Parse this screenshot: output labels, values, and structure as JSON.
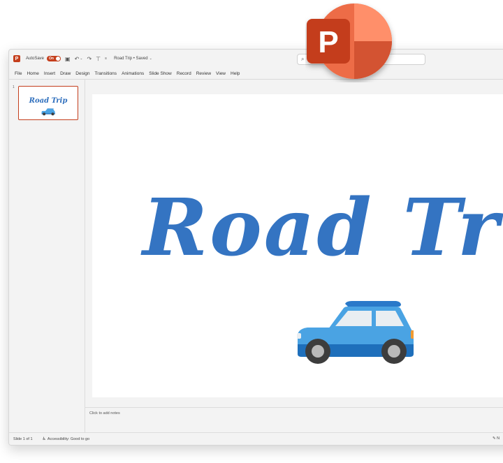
{
  "app": {
    "autosave_label": "AutoSave",
    "autosave_state": "On",
    "document_title": "Road Trip • Saved",
    "logo_letter": "P",
    "mini_logo_letter": "P",
    "accent_color": "#c43e1c"
  },
  "menu": [
    "File",
    "Home",
    "Insert",
    "Draw",
    "Design",
    "Transitions",
    "Animations",
    "Slide Show",
    "Record",
    "Review",
    "View",
    "Help"
  ],
  "thumbnails": [
    {
      "number": "1",
      "title": "Road Trip"
    }
  ],
  "slide": {
    "title": "Road Trip",
    "title_color": "#3474c2",
    "image": "car-icon"
  },
  "notes": {
    "placeholder": "Click to add notes"
  },
  "status": {
    "slide_count": "Slide 1 of 1",
    "accessibility": "Accessibility: Good to go",
    "right_text": "N"
  }
}
